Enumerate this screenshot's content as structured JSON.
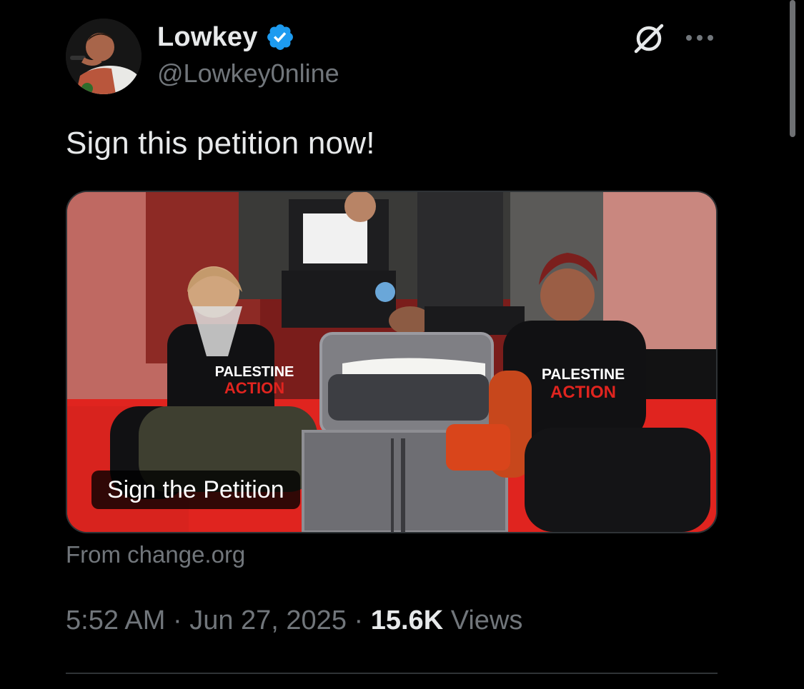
{
  "author": {
    "display_name": "Lowkey",
    "handle": "@Lowkey0nline",
    "verified_icon": "verified-badge-icon"
  },
  "actions": {
    "grok_icon": "grok-icon",
    "more_icon": "more-dots-icon"
  },
  "tweet": {
    "text": "Sign this petition now!"
  },
  "card": {
    "title": "Sign the Petition",
    "source": "From change.org",
    "shirt_text_line1": "PALESTINE",
    "shirt_text_line2": "ACTION"
  },
  "meta": {
    "time": "5:52 AM",
    "separator": "·",
    "date": "Jun 27, 2025",
    "views_count": "15.6K",
    "views_label": "Views"
  },
  "colors": {
    "background": "#000000",
    "primary_text": "#e7e9ea",
    "secondary_text": "#71767b",
    "verified_blue": "#1d9bf0",
    "border": "#2f3336"
  }
}
